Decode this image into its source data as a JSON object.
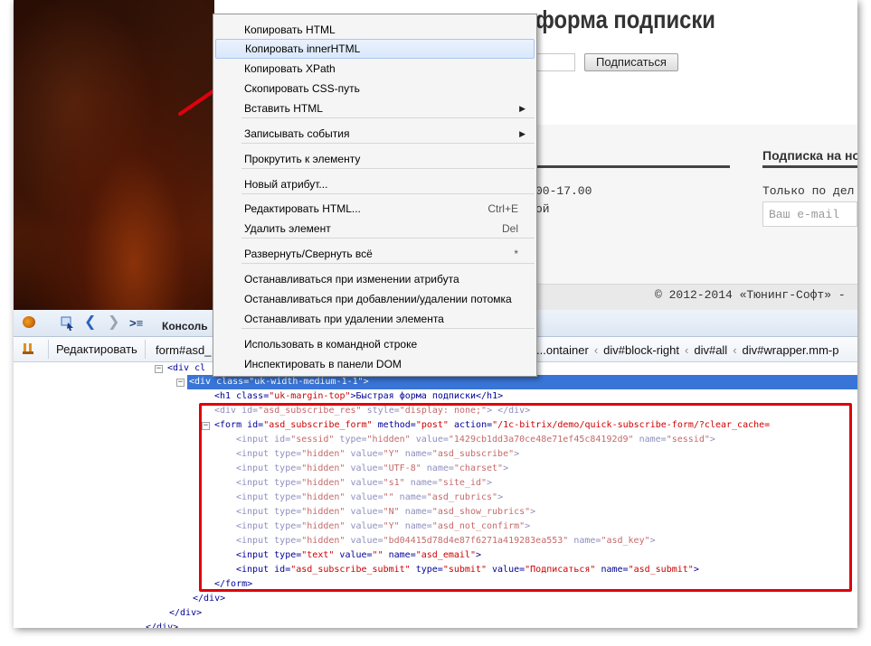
{
  "page": {
    "title": "форма подписки",
    "subscribe_button": "Подписаться",
    "right_heading": "Подписка на но",
    "hours_text": "00-17.00",
    "fragment_text": "ой",
    "right_text": "Только по дел",
    "email_placeholder": "Ваш e-mail",
    "copyright": "© 2012-2014 «Тюнинг-Софт» -"
  },
  "toolbar": {
    "console_tab": "Консоль",
    "edit_button": "Редактировать",
    "breadcrumb_left": "form#asd_",
    "breadcrumb_right": [
      "...ontainer",
      "div#block-right",
      "div#all",
      "div#wrapper.mm-p"
    ]
  },
  "context_menu": {
    "items": [
      {
        "label": "Копировать HTML",
        "shortcut": "",
        "submenu": false
      },
      {
        "label": "Копировать innerHTML",
        "shortcut": "",
        "submenu": false,
        "highlighted": true
      },
      {
        "label": "Копировать XPath",
        "shortcut": "",
        "submenu": false
      },
      {
        "label": "Скопировать CSS-путь",
        "shortcut": "",
        "submenu": false
      },
      {
        "label": "Вставить HTML",
        "shortcut": "",
        "submenu": true
      },
      {
        "label": "Записывать события",
        "shortcut": "",
        "submenu": true
      },
      {
        "label": "Прокрутить к элементу",
        "shortcut": "",
        "submenu": false
      },
      {
        "label": "Новый атрибут...",
        "shortcut": "",
        "submenu": false
      },
      {
        "label": "Редактировать HTML...",
        "shortcut": "Ctrl+E",
        "submenu": false
      },
      {
        "label": "Удалить элемент",
        "shortcut": "Del",
        "submenu": false
      },
      {
        "label": "Развернуть/Свернуть всё",
        "shortcut": "*",
        "submenu": false
      },
      {
        "label": "Останавливаться при изменении атрибута",
        "shortcut": "",
        "submenu": false
      },
      {
        "label": "Останавливаться при добавлении/удалении потомка",
        "shortcut": "",
        "submenu": false
      },
      {
        "label": "Останавливать при удалении элемента",
        "shortcut": "",
        "submenu": false
      },
      {
        "label": "Использовать в командной строке",
        "shortcut": "",
        "submenu": false
      },
      {
        "label": "Инспектировать в панели DOM",
        "shortcut": "",
        "submenu": false
      }
    ]
  },
  "code": {
    "line_div_cl": "<div cl",
    "line_div_selected": "<div class=\"uk-width-medium-1-1\">",
    "line_h1": [
      "<h1",
      "class=",
      "\"uk-margin-top\"",
      ">Быстрая форма подписки</h1>"
    ],
    "line_div_res": [
      "<div",
      "id=",
      "\"asd_subscribe_res\"",
      "style=",
      "\"display: none;\"",
      "> </div>"
    ],
    "line_form": [
      "<form",
      "id=",
      "\"asd_subscribe_form\"",
      "method=",
      "\"post\"",
      "action=",
      "\"/1c-bitrix/demo/quick-subscribe-form/?clear_cache="
    ],
    "inputs": [
      {
        "attrs": [
          [
            "id=",
            "\"sessid\""
          ],
          [
            "type=",
            "\"hidden\""
          ],
          [
            "value=",
            "\"1429cb1dd3a70ce48e71ef45c84192d9\""
          ],
          [
            "name=",
            "\"sessid\""
          ]
        ],
        "hidden": true
      },
      {
        "attrs": [
          [
            "type=",
            "\"hidden\""
          ],
          [
            "value=",
            "\"Y\""
          ],
          [
            "name=",
            "\"asd_subscribe\""
          ]
        ],
        "hidden": true
      },
      {
        "attrs": [
          [
            "type=",
            "\"hidden\""
          ],
          [
            "value=",
            "\"UTF-8\""
          ],
          [
            "name=",
            "\"charset\""
          ]
        ],
        "hidden": true
      },
      {
        "attrs": [
          [
            "type=",
            "\"hidden\""
          ],
          [
            "value=",
            "\"s1\""
          ],
          [
            "name=",
            "\"site_id\""
          ]
        ],
        "hidden": true
      },
      {
        "attrs": [
          [
            "type=",
            "\"hidden\""
          ],
          [
            "value=",
            "\"\""
          ],
          [
            "name=",
            "\"asd_rubrics\""
          ]
        ],
        "hidden": true
      },
      {
        "attrs": [
          [
            "type=",
            "\"hidden\""
          ],
          [
            "value=",
            "\"N\""
          ],
          [
            "name=",
            "\"asd_show_rubrics\""
          ]
        ],
        "hidden": true
      },
      {
        "attrs": [
          [
            "type=",
            "\"hidden\""
          ],
          [
            "value=",
            "\"Y\""
          ],
          [
            "name=",
            "\"asd_not_confirm\""
          ]
        ],
        "hidden": true
      },
      {
        "attrs": [
          [
            "type=",
            "\"hidden\""
          ],
          [
            "value=",
            "\"bd04415d78d4e87f6271a419283ea553\""
          ],
          [
            "name=",
            "\"asd_key\""
          ]
        ],
        "hidden": true
      },
      {
        "attrs": [
          [
            "type=",
            "\"text\""
          ],
          [
            "value=",
            "\"\""
          ],
          [
            "name=",
            "\"asd_email\""
          ]
        ],
        "hidden": false
      },
      {
        "attrs": [
          [
            "id=",
            "\"asd_subscribe_submit\""
          ],
          [
            "type=",
            "\"submit\""
          ],
          [
            "value=",
            "\"Подписаться\""
          ],
          [
            "name=",
            "\"asd_submit\""
          ]
        ],
        "hidden": false
      }
    ],
    "input_tag": "<input",
    "close_tag_end": ">",
    "line_form_close": "</form>",
    "line_div_close": "</div>",
    "tree_toggle_minus": "−"
  },
  "colors": {
    "selection": "#3875d7",
    "annotation_red": "#e0000d",
    "tag": "#000099",
    "value": "#cc0000"
  }
}
